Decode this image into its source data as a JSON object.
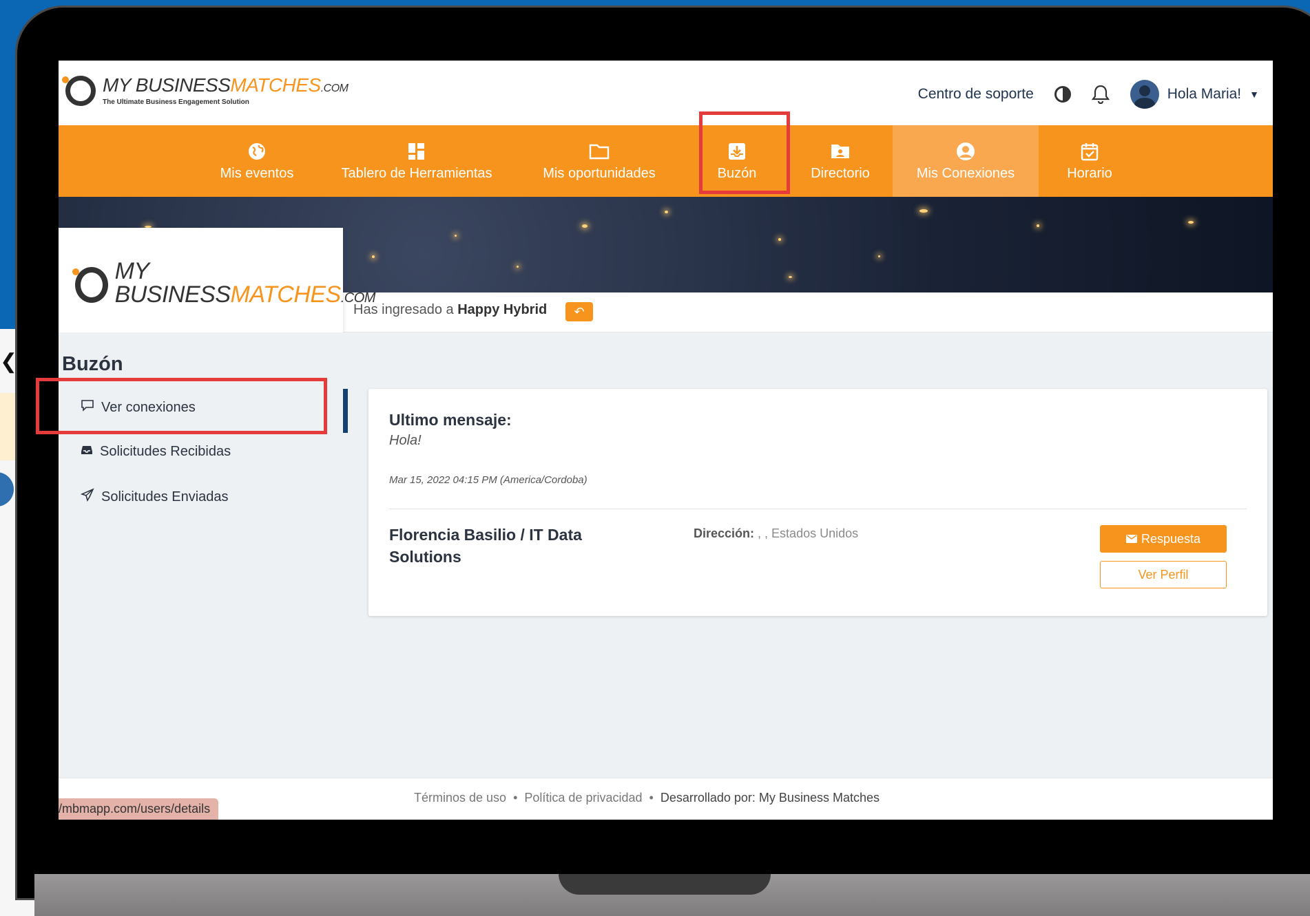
{
  "header": {
    "logo": {
      "main_1": "MY BUSINESS",
      "main_2": "MATCHES",
      "suffix": ".COM",
      "tagline": "The Ultimate Business Engagement Solution"
    },
    "support_link": "Centro de soporte",
    "user_greeting": "Hola Maria!"
  },
  "nav": {
    "items": [
      {
        "label": "Mis eventos",
        "icon": "globe-icon"
      },
      {
        "label": "Tablero de Herramientas",
        "icon": "dashboard-icon"
      },
      {
        "label": "Mis oportunidades",
        "icon": "folder-icon"
      },
      {
        "label": "Buzón",
        "icon": "inbox-icon"
      },
      {
        "label": "Directorio",
        "icon": "directory-icon"
      },
      {
        "label": "Mis Conexiones",
        "icon": "user-circle-icon"
      },
      {
        "label": "Horario",
        "icon": "calendar-check-icon"
      }
    ],
    "active": "Mis Conexiones",
    "highlighted": "Buzón"
  },
  "event_bar": {
    "prefix": "Has ingresado a",
    "event_name": "Happy Hybrid",
    "back_icon": "reply-icon"
  },
  "sidebar": {
    "title": "Buzón",
    "items": [
      {
        "label": "Ver conexiones",
        "icon": "chat-icon"
      },
      {
        "label": "Solicitudes Recibidas",
        "icon": "inbox-tray-icon"
      },
      {
        "label": "Solicitudes Enviadas",
        "icon": "paper-plane-icon"
      }
    ]
  },
  "message_card": {
    "title": "Ultimo mensaje:",
    "message": "Hola!",
    "date": "Mar 15, 2022 04:15 PM (America/Cordoba)",
    "contact_name": "Florencia Basilio / IT Data Solutions",
    "address_label": "Dirección:",
    "address_value": ", , Estados Unidos",
    "reply_button": "Respuesta",
    "profile_button": "Ver Perfil"
  },
  "footer": {
    "terms": "Términos de uso",
    "privacy": "Política de privacidad",
    "developed": "Desarrollado por: My Business Matches",
    "separator": "•"
  },
  "status_url": "/mbmapp.com/users/details",
  "colors": {
    "brand_orange": "#f7941d",
    "highlight_red": "#e53b3b",
    "nav_dark_blue": "#12426e"
  }
}
